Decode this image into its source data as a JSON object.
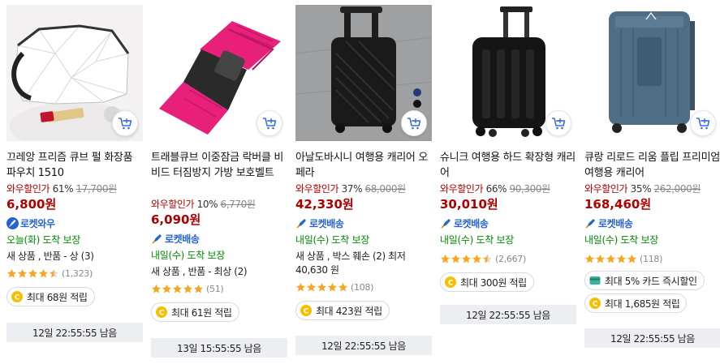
{
  "colors": {
    "price": "#ae0000",
    "rocket": "#2563d1",
    "delivery": "#008c00",
    "star": "#f5a623",
    "timer_bg": "#eceef2"
  },
  "products": [
    {
      "title": "끄레앙 프리즘 큐브 펄 화장품 파우치 1510",
      "discount_label": "와우할인가",
      "discount_rate": "61%",
      "original_price": "17,700원",
      "price": "6,800원",
      "badge": "로켓와우",
      "badge_icon": "rocket-wow-icon",
      "delivery": "오늘(화) 도착 보장",
      "condition": "새 상품 , 반품 - 상 (3)",
      "rating_count": "(1,323)",
      "rating": 4.5,
      "pills": [
        "최대 68원 적립"
      ],
      "timer": "12일 22:55:55 남음"
    },
    {
      "title": "트래블큐브 이중잠금 락버클 비비드 터짐방지 가방 보호벨트",
      "discount_label": "와우할인가",
      "discount_rate": "10%",
      "original_price": "6,770원",
      "price": "6,090원",
      "badge": "로켓배송",
      "badge_icon": "rocket-icon",
      "delivery": "내일(수) 도착 보장",
      "condition": "새 상품 , 반품 - 최상 (2)",
      "rating_count": "(51)",
      "rating": 5,
      "pills": [
        "최대 61원 적립"
      ],
      "timer": "13일 15:55:55 남음"
    },
    {
      "title": "아날도바시니 여행용 캐리어 오페라",
      "discount_label": "와우할인가",
      "discount_rate": "37%",
      "original_price": "68,000원",
      "price": "42,330원",
      "badge": "로켓배송",
      "badge_icon": "rocket-icon",
      "delivery": "내일(수) 도착 보장",
      "condition": "새 상품 , 박스 훼손 (2) 최저 40,630 원",
      "rating_count": "(108)",
      "rating": 5,
      "pills": [
        "최대 423원 적립"
      ],
      "timer": "12일 22:55:55 남음"
    },
    {
      "title": "슈니크 여행용 하드 확장형 캐리어",
      "discount_label": "와우할인가",
      "discount_rate": "66%",
      "original_price": "90,300원",
      "price": "30,010원",
      "badge": "로켓배송",
      "badge_icon": "rocket-icon",
      "delivery": "내일(수) 도착 보장",
      "condition": "",
      "rating_count": "(2,667)",
      "rating": 4.5,
      "pills": [
        "최대 300원 적립"
      ],
      "timer": "12일 22:55:55 남음"
    },
    {
      "title": "큐랑 리로드 리움 플립 프리미엄 여행용 캐리어",
      "discount_label": "와우할인가",
      "discount_rate": "35%",
      "original_price": "262,000원",
      "price": "168,460원",
      "badge": "로켓배송",
      "badge_icon": "rocket-icon",
      "delivery": "내일(수) 도착 보장",
      "condition": "",
      "rating_count": "(118)",
      "rating": 5,
      "pills": [
        "최대 5% 카드 즉시할인",
        "최대 1,685원 적립"
      ],
      "timer": "12일 22:55:55 남음"
    }
  ]
}
